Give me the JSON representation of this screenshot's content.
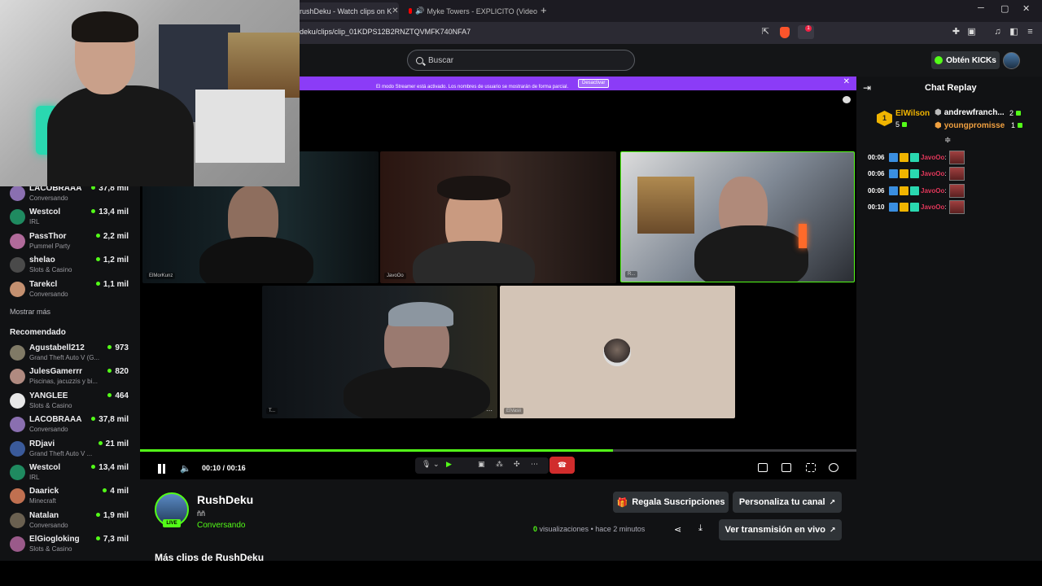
{
  "browser": {
    "tabs": [
      {
        "title": "rushDeku - Watch clips on K"
      },
      {
        "title": "Myke Towers - EXPLICITO (Video"
      }
    ],
    "url": "deku/clips/clip_01KDPS12B2RNZTQVMFK740NFA7"
  },
  "header": {
    "search_placeholder": "Buscar",
    "get_kicks": "Obtén KICKs"
  },
  "sidebar": {
    "following": [
      {
        "name": "LACOBRAAA",
        "category": "Conversando",
        "viewers": "37,8 mil",
        "color": "#8a6fb0"
      },
      {
        "name": "Westcol",
        "category": "IRL",
        "viewers": "13,4 mil",
        "color": "#1f8a60"
      },
      {
        "name": "PassThor",
        "category": "Pummel Party",
        "viewers": "2,2 mil",
        "color": "#b06a9a"
      },
      {
        "name": "shelao",
        "category": "Slots & Casino",
        "viewers": "1,2 mil",
        "color": "#4a4a4a"
      },
      {
        "name": "Tarekcl",
        "category": "Conversando",
        "viewers": "1,1 mil",
        "color": "#c49070"
      }
    ],
    "show_more": "Mostrar más",
    "recommended_title": "Recomendado",
    "recommended": [
      {
        "name": "Agustabell212",
        "category": "Grand Theft Auto V (G...",
        "viewers": "973",
        "color": "#807a66"
      },
      {
        "name": "JulesGamerrr",
        "category": "Piscinas, jacuzzis y bi...",
        "viewers": "820",
        "color": "#b08a80"
      },
      {
        "name": "YANGLEE",
        "category": "Slots & Casino",
        "viewers": "464",
        "color": "#e8e8e8"
      },
      {
        "name": "LACOBRAAA",
        "category": "Conversando",
        "viewers": "37,8 mil",
        "color": "#8a6fb0"
      },
      {
        "name": "RDjavi",
        "category": "Grand Theft Auto V ...",
        "viewers": "21 mil",
        "color": "#3a5a9a"
      },
      {
        "name": "Westcol",
        "category": "IRL",
        "viewers": "13,4 mil",
        "color": "#1f8a60"
      },
      {
        "name": "Daarick",
        "category": "Minecraft",
        "viewers": "4 mil",
        "color": "#c07050"
      },
      {
        "name": "Natalan",
        "category": "Conversando",
        "viewers": "1,9 mil",
        "color": "#6a6050"
      },
      {
        "name": "ElGiogloking",
        "category": "Slots & Casino",
        "viewers": "7,3 mil",
        "color": "#9a5a8a"
      }
    ]
  },
  "streamer_mode": {
    "message": "El modo Streamer está activado. Los nombres de usuario se mostrarán de forma parcial.",
    "button": "Desactivar"
  },
  "tiles": [
    {
      "label": "ElMorKunz"
    },
    {
      "label": "JavoOo"
    },
    {
      "label": "R..."
    },
    {
      "label": "T..."
    },
    {
      "label": "ElVasii"
    }
  ],
  "player": {
    "current": "00:10",
    "sep": "/",
    "duration": "00:16",
    "progress": 0.66
  },
  "channel": {
    "name": "RushDeku",
    "title": "ññ",
    "category": "Conversando",
    "live": "LIVE",
    "gift_subs": "Regala Suscripciones",
    "customize": "Personaliza tu canal",
    "views_count": "0",
    "views_label": "visualizaciones",
    "ago": "hace 2 minutos",
    "watch_live": "Ver transmisión en vivo",
    "more_clips": "Más clips de RushDeku"
  },
  "chat": {
    "title": "Chat Replay",
    "gifters": [
      {
        "rank": "1",
        "name": "ElWilson",
        "count": "5",
        "color": "#f0b400"
      },
      {
        "name": "andrewfranch...",
        "count": "2",
        "color": "#ffffff"
      },
      {
        "name": "youngpromisse",
        "count": "1",
        "color": "#f0a040"
      }
    ],
    "messages": [
      {
        "time": "00:06",
        "user": "JavoOo",
        "sep": ":"
      },
      {
        "time": "00:06",
        "user": "JavoOo",
        "sep": ":"
      },
      {
        "time": "00:06",
        "user": "JavoOo",
        "sep": ":"
      },
      {
        "time": "00:10",
        "user": "JavoOo",
        "sep": ":"
      }
    ]
  }
}
